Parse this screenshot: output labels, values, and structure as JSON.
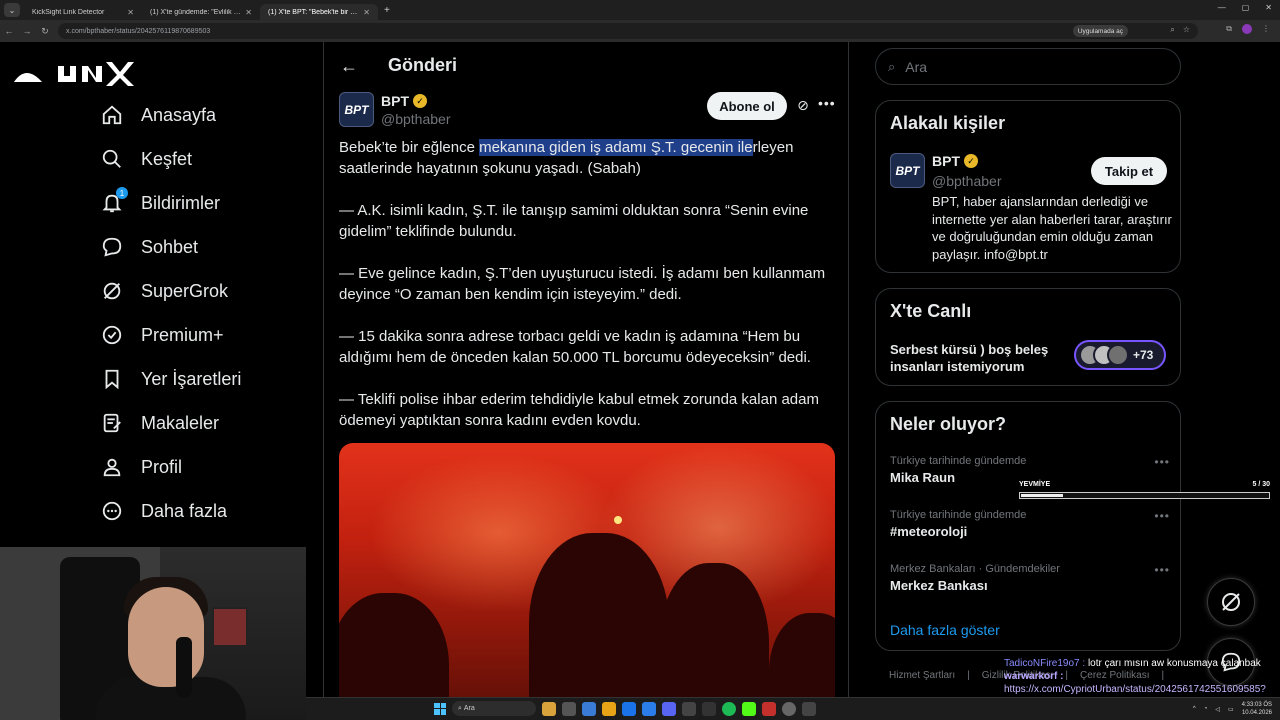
{
  "browser": {
    "tabs": [
      {
        "title": "KickSight Link Detector",
        "active": false
      },
      {
        "title": "(1) X'te gündemde: \"Evlilik için g",
        "active": false
      },
      {
        "title": "(1) X'te BPT: \"Bebek'te bir eğlen",
        "active": true
      }
    ],
    "url": "x.com/bpthaber/status/2042576119870689503",
    "app_pill": "Uygulamada aç"
  },
  "nav": {
    "items": [
      {
        "label": "Anasayfa",
        "icon": "home-icon"
      },
      {
        "label": "Keşfet",
        "icon": "search-icon"
      },
      {
        "label": "Bildirimler",
        "icon": "bell-icon",
        "badge": "1"
      },
      {
        "label": "Sohbet",
        "icon": "chat-icon"
      },
      {
        "label": "SuperGrok",
        "icon": "grok-icon"
      },
      {
        "label": "Premium+",
        "icon": "premium-icon"
      },
      {
        "label": "Yer İşaretleri",
        "icon": "bookmark-icon"
      },
      {
        "label": "Makaleler",
        "icon": "articles-icon"
      },
      {
        "label": "Profil",
        "icon": "profile-icon"
      },
      {
        "label": "Daha fazla",
        "icon": "more-circle-icon"
      }
    ]
  },
  "post": {
    "header_title": "Gönderi",
    "author_name": "BPT",
    "author_handle": "@bpthaber",
    "avatar_text": "BPT",
    "subscribe_label": "Abone ol",
    "paragraphs": [
      {
        "before": "Bebek’te bir eğlence ",
        "highlight": "mekanına giden iş adamı Ş.T. gecenin ile",
        "after": "rleyen saatlerinde hayatının şokunu yaşadı. (Sabah)"
      },
      {
        "before": "— A.K. isimli kadın, Ş.T. ile tanışıp samimi olduktan sonra “Senin evine gidelim” teklifinde bulundu.",
        "highlight": "",
        "after": ""
      },
      {
        "before": "— Eve gelince kadın, Ş.T’den uyuşturucu istedi. İş adamı ben kullanmam deyince “O zaman ben kendim için isteyeyim.” dedi.",
        "highlight": "",
        "after": ""
      },
      {
        "before": "— 15 dakika sonra adrese torbacı geldi ve kadın iş adamına “Hem bu aldığımı hem de önceden kalan 50.000 TL borcumu ödeyeceksin” dedi.",
        "highlight": "",
        "after": ""
      },
      {
        "before": "— Teklifi polise ihbar ederim tehdidiyle kabul etmek zorunda kalan adam ödemeyi yaptıktan sonra kadını evden kovdu.",
        "highlight": "",
        "after": ""
      }
    ]
  },
  "sidebar": {
    "search_placeholder": "Ara",
    "related": {
      "title": "Alakalı kişiler",
      "name": "BPT",
      "handle": "@bpthaber",
      "avatar_text": "BPT",
      "follow_label": "Takip et",
      "bio": "BPT, haber ajanslarından derlediği ve internette yer alan haberleri tarar, araştırır ve doğruluğundan emin olduğu zaman paylaşır. info@bpt.tr"
    },
    "live": {
      "title": "X'te Canlı",
      "space_title": "Serbest kürsü ) boş beleş insanları istemiyorum",
      "listener_count": "+73"
    },
    "trends": {
      "title": "Neler oluyor?",
      "items": [
        {
          "meta": "Türkiye tarihinde gündemde",
          "name": "Mika Raun"
        },
        {
          "meta": "Türkiye tarihinde gündemde",
          "name": "#meteoroloji"
        },
        {
          "meta": "Merkez Bankaları · Gündemdekiler",
          "name": "Merkez Bankası"
        }
      ],
      "show_more": "Daha fazla göster"
    },
    "footer_links": [
      "Hizmet Şartları",
      "|",
      "Gizlilik Politikası",
      "|",
      "Çerez Politikası",
      "|"
    ]
  },
  "overlay": {
    "progress_label": "YEVMİYE",
    "progress_count": "5 / 30",
    "progress_fraction": 0.1667
  },
  "chat": [
    {
      "user": "TadiсoNFire19o7 :",
      "message": "lotr çarı mısın aw konusmaya çalanbak"
    },
    {
      "user": "warwarkorf :",
      "message": "https://x.com/CypriotUrban/status/2042561742551609585?s=20"
    }
  ],
  "taskbar": {
    "search_label": "Ara",
    "time": "4:33:03 ÖS",
    "date": "10.04.2026"
  }
}
